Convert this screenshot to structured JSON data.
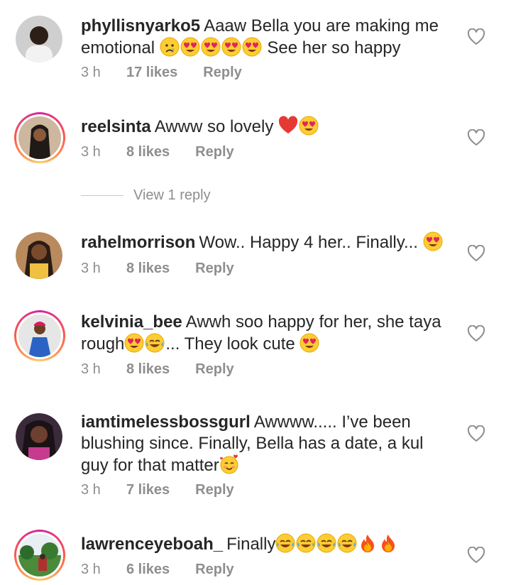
{
  "comments": [
    {
      "username": "phyllisnyarko5",
      "text": "Aaaw Bella you are making me emotional",
      "text2": "See her so happy",
      "time": "3 h",
      "likes": "17 likes",
      "reply": "Reply",
      "avatar_bg": "#d9d9d9"
    },
    {
      "username": "reelsinta",
      "text": "Awww so lovely",
      "time": "3 h",
      "likes": "8 likes",
      "reply": "Reply",
      "avatar_bg": "#6b5a4a"
    },
    {
      "username": "rahelmorrison",
      "text": "Wow.. Happy 4 her.. Finally...",
      "time": "3 h",
      "likes": "8 likes",
      "reply": "Reply",
      "avatar_bg": "#5a4535"
    },
    {
      "username": "kelvinia_bee",
      "text": "Awwh soo happy for her,  she taya rough",
      "text2": "... They look cute",
      "time": "3 h",
      "likes": "8 likes",
      "reply": "Reply",
      "avatar_bg": "#3b6fb8"
    },
    {
      "username": "iamtimelessbossgurl",
      "text": "Awwww..... I’ve been blushing since. Finally, Bella has a date, a kul guy for that matter",
      "time": "3 h",
      "likes": "7 likes",
      "reply": "Reply",
      "avatar_bg": "#4a3a4a"
    },
    {
      "username": "lawrenceyeboah_",
      "text": "Finally",
      "time": "3 h",
      "likes": "6 likes",
      "reply": "Reply",
      "avatar_bg": "#4f8a3a"
    }
  ],
  "view_replies": "View 1 reply",
  "colors": {
    "text": "#262626",
    "meta": "#8e8e8e",
    "heart_outline": "#8e8e8e",
    "ring_start": "#d6249f",
    "ring_end": "#fccc63"
  },
  "icons": {
    "like": "heart-outline-icon",
    "emoji_heart_eyes": "smiling-face-with-heart-eyes",
    "emoji_tears": "crying-face",
    "emoji_joy": "face-with-tears-of-joy",
    "emoji_fire": "fire",
    "emoji_red_heart": "red-heart",
    "emoji_smiling_hearts": "smiling-face-with-hearts"
  }
}
